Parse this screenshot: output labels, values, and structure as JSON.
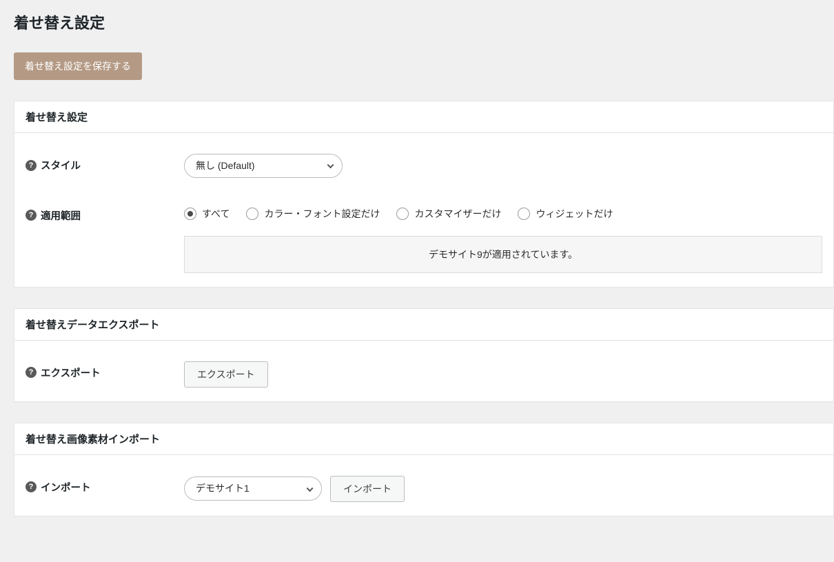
{
  "page_title": "着せ替え設定",
  "save_button": "着せ替え設定を保存する",
  "sections": {
    "settings": {
      "title": "着せ替え設定",
      "style": {
        "label": "スタイル",
        "selected": "無し (Default)"
      },
      "scope": {
        "label": "適用範囲",
        "options": [
          {
            "label": "すべて",
            "checked": true
          },
          {
            "label": "カラー・フォント設定だけ",
            "checked": false
          },
          {
            "label": "カスタマイザーだけ",
            "checked": false
          },
          {
            "label": "ウィジェットだけ",
            "checked": false
          }
        ],
        "notice": "デモサイト9が適用されています。"
      }
    },
    "export": {
      "title": "着せ替えデータエクスポート",
      "label": "エクスポート",
      "button": "エクスポート"
    },
    "import": {
      "title": "着せ替え画像素材インポート",
      "label": "インポート",
      "selected": "デモサイト1",
      "button": "インポート"
    }
  }
}
